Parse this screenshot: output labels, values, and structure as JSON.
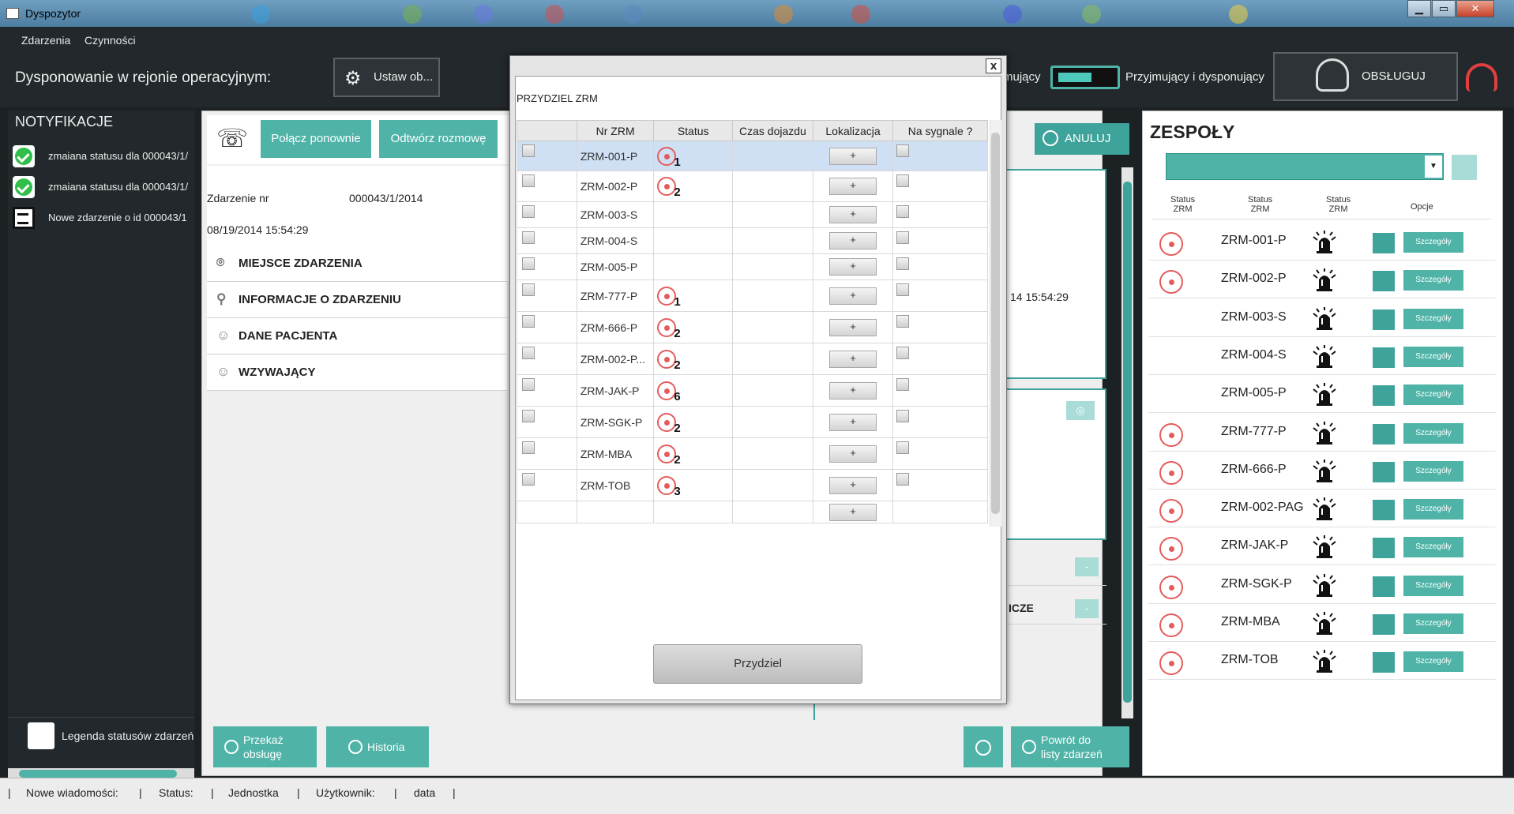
{
  "window": {
    "title": "Dyspozytor",
    "btn_min": "▁",
    "btn_max": "▭",
    "btn_close": "✕"
  },
  "menu": [
    "Zdarzenia",
    "Czynności"
  ],
  "topbar": {
    "region_label": "Dysponowanie w rejonie operacyjnym:",
    "set_button": "Ustaw ob...",
    "mode_left": "mujący",
    "mode_right": "Przyjmujący i dysponujący",
    "serve_button": "OBSŁUGUJ"
  },
  "notifications": {
    "title": "NOTYFIKACJE",
    "items": [
      {
        "text": "zmaiana statusu dla 000043/1/",
        "icon": "check-icon"
      },
      {
        "text": "zmaiana statusu dla 000043/1/",
        "icon": "check-icon"
      },
      {
        "text": "Nowe zdarzenie o id 000043/1",
        "icon": "new-event-icon"
      }
    ],
    "legend": "Legenda statusów zdarzeń"
  },
  "call": {
    "reconnect": "Połącz ponownie",
    "play": "Odtwórz rozmowę",
    "cancel": "ANULUJ"
  },
  "event": {
    "number_label": "Zdarzenie nr",
    "number_value": "000043/1/2014",
    "datetime": "08/19/2014 15:54:29",
    "datetime_partial": "14 15:54:29",
    "sections": [
      "MIEJSCE ZDARZENIA",
      "INFORMACJE O ZDARZENIU",
      "DANE PACJENTA",
      "WZYWAJĄCY"
    ],
    "partial_section": "ICZE",
    "small_btn": "-"
  },
  "bottom_buttons": {
    "transfer": "Przekaż obsługę",
    "transfer_l1": "Przekaż",
    "transfer_l2": "obsługę",
    "history": "Historia",
    "back_l1": "Powrót do",
    "back_l2": "listy zdarzeń"
  },
  "modal": {
    "title": "PRZYDZIEL ZRM",
    "close": "x",
    "columns": [
      "Nr ZRM",
      "Status",
      "Czas dojazdu",
      "Lokalizacja",
      "Na sygnale ?"
    ],
    "rows": [
      {
        "nr": "ZRM-001-P",
        "status": "1",
        "selected": true
      },
      {
        "nr": "ZRM-002-P",
        "status": "2"
      },
      {
        "nr": "ZRM-003-S",
        "status": ""
      },
      {
        "nr": "ZRM-004-S",
        "status": ""
      },
      {
        "nr": "ZRM-005-P",
        "status": ""
      },
      {
        "nr": "ZRM-777-P",
        "status": "1"
      },
      {
        "nr": "ZRM-666-P",
        "status": "2"
      },
      {
        "nr": "ZRM-002-P...",
        "status": "2"
      },
      {
        "nr": "ZRM-JAK-P",
        "status": "6"
      },
      {
        "nr": "ZRM-SGK-P",
        "status": "2"
      },
      {
        "nr": "ZRM-MBA",
        "status": "2"
      },
      {
        "nr": "ZRM-TOB",
        "status": "3"
      }
    ],
    "plus_label": "+",
    "assign_button": "Przydziel"
  },
  "teams": {
    "title": "ZESPOŁY",
    "headers": [
      "Status ZRM",
      "Status ZRM",
      "Status ZRM",
      "Opcje"
    ],
    "header_l1": "Status",
    "header_l2": "ZRM",
    "details_label": "Szczegóły",
    "rows": [
      {
        "name": "ZRM-001-P",
        "has_status": true
      },
      {
        "name": "ZRM-002-P",
        "has_status": true
      },
      {
        "name": "ZRM-003-S",
        "has_status": false
      },
      {
        "name": "ZRM-004-S",
        "has_status": false
      },
      {
        "name": "ZRM-005-P",
        "has_status": false
      },
      {
        "name": "ZRM-777-P",
        "has_status": true
      },
      {
        "name": "ZRM-666-P",
        "has_status": true
      },
      {
        "name": "ZRM-002-PAG",
        "has_status": true
      },
      {
        "name": "ZRM-JAK-P",
        "has_status": true
      },
      {
        "name": "ZRM-SGK-P",
        "has_status": true
      },
      {
        "name": "ZRM-MBA",
        "has_status": true
      },
      {
        "name": "ZRM-TOB",
        "has_status": true
      }
    ]
  },
  "statusbar": {
    "messages": "Nowe wiadomości:",
    "status": "Status:",
    "unit": "Jednostka",
    "user": "Użytkownik:",
    "date": "data",
    "sep": "|"
  },
  "colors": {
    "accent": "#4fb3a7",
    "status_red": "#e55b5b",
    "dark_bg": "#22282b"
  }
}
